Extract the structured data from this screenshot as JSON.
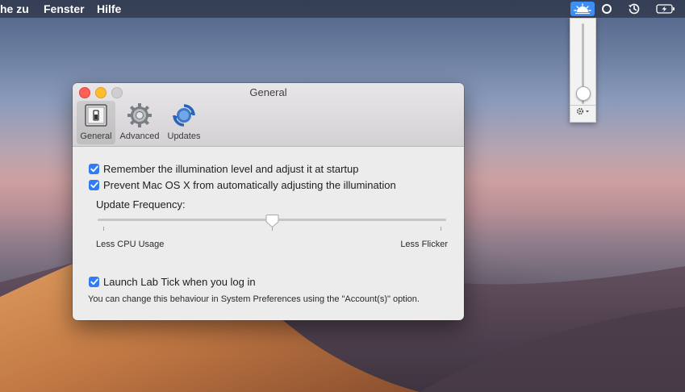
{
  "menubar": {
    "items": [
      "he zu",
      "Fenster",
      "Hilfe"
    ],
    "status_icons": [
      "brightness-icon",
      "circle-icon",
      "time-machine-icon",
      "battery-charging-icon"
    ]
  },
  "popover": {
    "level": 0.08,
    "gear_icon": "gear-icon"
  },
  "window": {
    "title": "General",
    "toolbar": [
      {
        "label": "General",
        "icon": "switch-icon",
        "selected": true
      },
      {
        "label": "Advanced",
        "icon": "gear-icon",
        "selected": false
      },
      {
        "label": "Updates",
        "icon": "updates-icon",
        "selected": false
      }
    ],
    "options": {
      "remember": {
        "label": "Remember the illumination level and adjust it at startup",
        "checked": true
      },
      "prevent": {
        "label": "Prevent Mac OS X from automatically adjusting the illumination",
        "checked": true
      }
    },
    "update_frequency": {
      "label": "Update Frequency:",
      "value_fraction": 0.5,
      "min_label": "Less CPU Usage",
      "max_label": "Less Flicker"
    },
    "launch": {
      "label": "Launch Lab Tick when you log in",
      "checked": true,
      "note": "You can change this behaviour in System Preferences using the \"Account(s)\" option."
    }
  },
  "colors": {
    "accent": "#2f7cf6",
    "close": "#fe5f57",
    "minimize": "#febc2e"
  }
}
